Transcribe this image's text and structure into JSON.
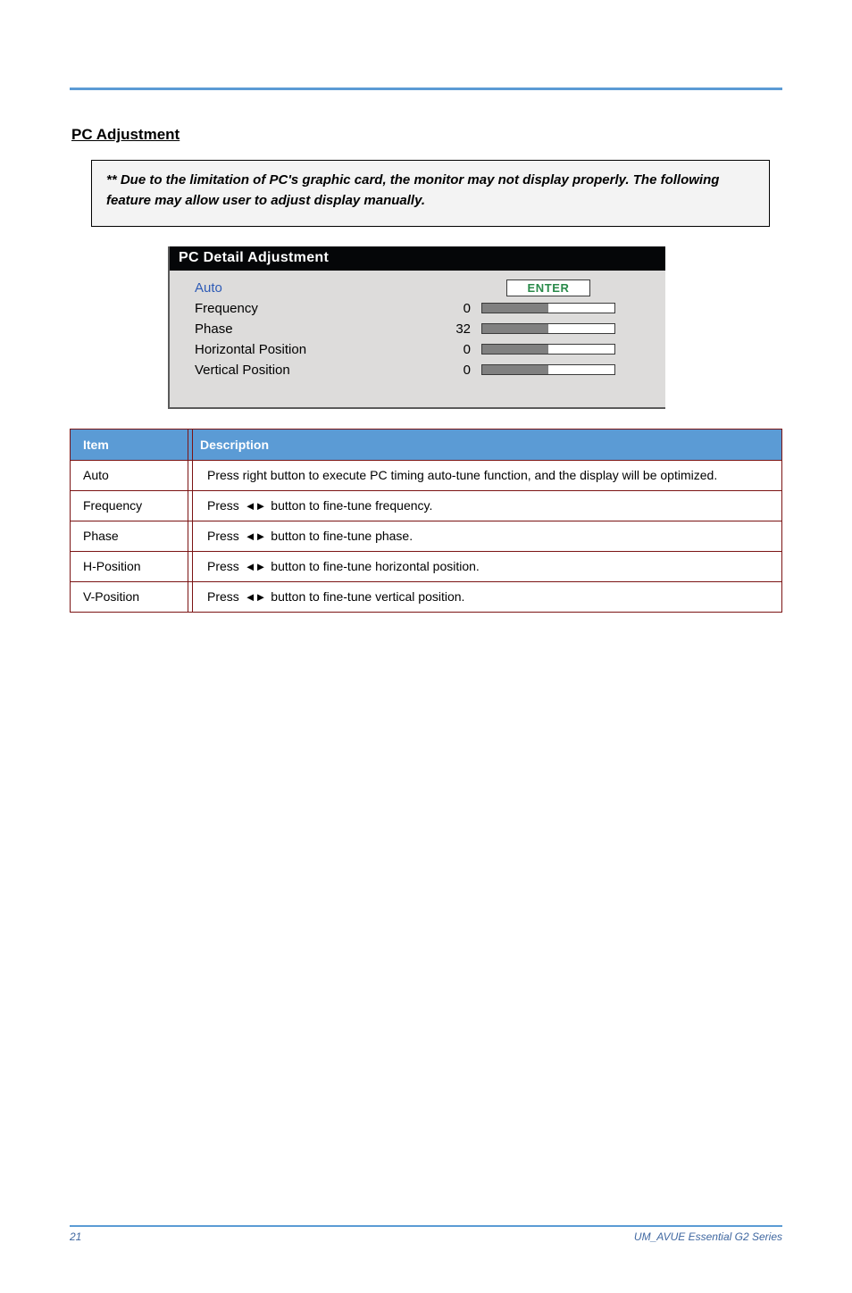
{
  "section_title": "PC Adjustment",
  "notice_text": "** Due to the limitation of PC's graphic card, the monitor may not display properly. The following feature may allow user to adjust display manually.",
  "osd": {
    "title": "PC Detail Adjustment",
    "enter_label": "ENTER",
    "rows": [
      {
        "label": "Auto",
        "value": "",
        "type": "enter"
      },
      {
        "label": "Frequency",
        "value": "0",
        "fill": 50
      },
      {
        "label": "Phase",
        "value": "32",
        "fill": 50
      },
      {
        "label": "Horizontal Position",
        "value": "0",
        "fill": 50
      },
      {
        "label": "Vertical Position",
        "value": "0",
        "fill": 50
      }
    ]
  },
  "table": {
    "item_header": "Item",
    "desc_header": "Description",
    "rows": [
      {
        "item": "Auto",
        "desc": "Press right button to execute PC timing auto-tune function, and the display will be optimized."
      },
      {
        "item": "Frequency",
        "desc_pre": "Press ",
        "desc_post": " button to fine-tune frequency."
      },
      {
        "item": "Phase",
        "desc_pre": "Press ",
        "desc_post": " button to fine-tune phase."
      },
      {
        "item": "H-Position",
        "desc_pre": "Press ",
        "desc_post": " button to fine-tune horizontal position."
      },
      {
        "item": "V-Position",
        "desc_pre": "Press ",
        "desc_post": " button to fine-tune vertical position."
      }
    ]
  },
  "footer": {
    "page": "21",
    "doc": "UM_AVUE Essential G2 Series"
  }
}
